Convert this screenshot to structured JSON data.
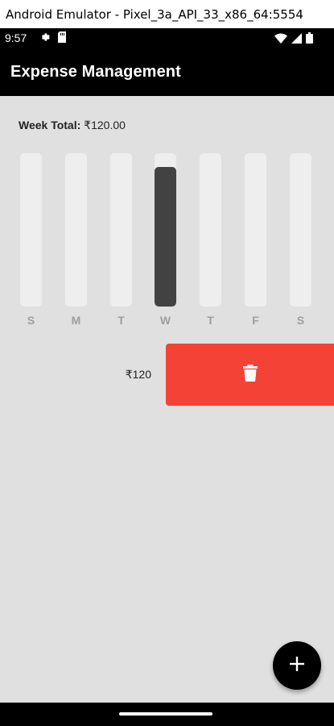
{
  "window": {
    "title": "Android Emulator - Pixel_3a_API_33_x86_64:5554"
  },
  "status_bar": {
    "time": "9:57",
    "icons_left": [
      "settings-icon",
      "sd-card-icon"
    ],
    "icons_right": [
      "wifi-icon",
      "signal-icon",
      "battery-icon"
    ]
  },
  "app_bar": {
    "title": "Expense Management"
  },
  "week_total": {
    "label": "Week Total:",
    "value": "₹120.00"
  },
  "chart_data": {
    "type": "bar",
    "categories": [
      "S",
      "M",
      "T",
      "W",
      "T",
      "F",
      "S"
    ],
    "values": [
      0,
      0,
      0,
      120,
      0,
      0,
      0
    ],
    "fractions_of_week_total": [
      0,
      0,
      0,
      0.91,
      0,
      0,
      0
    ]
  },
  "expenses": [
    {
      "amount": "₹120",
      "action_icon": "trash-icon"
    }
  ],
  "fab": {
    "icon": "plus-icon"
  },
  "colors": {
    "app_bar": "#000000",
    "background": "#e0e0e0",
    "bar_track": "#eeeeee",
    "bar_fill": "#424242",
    "delete": "#f44336"
  }
}
